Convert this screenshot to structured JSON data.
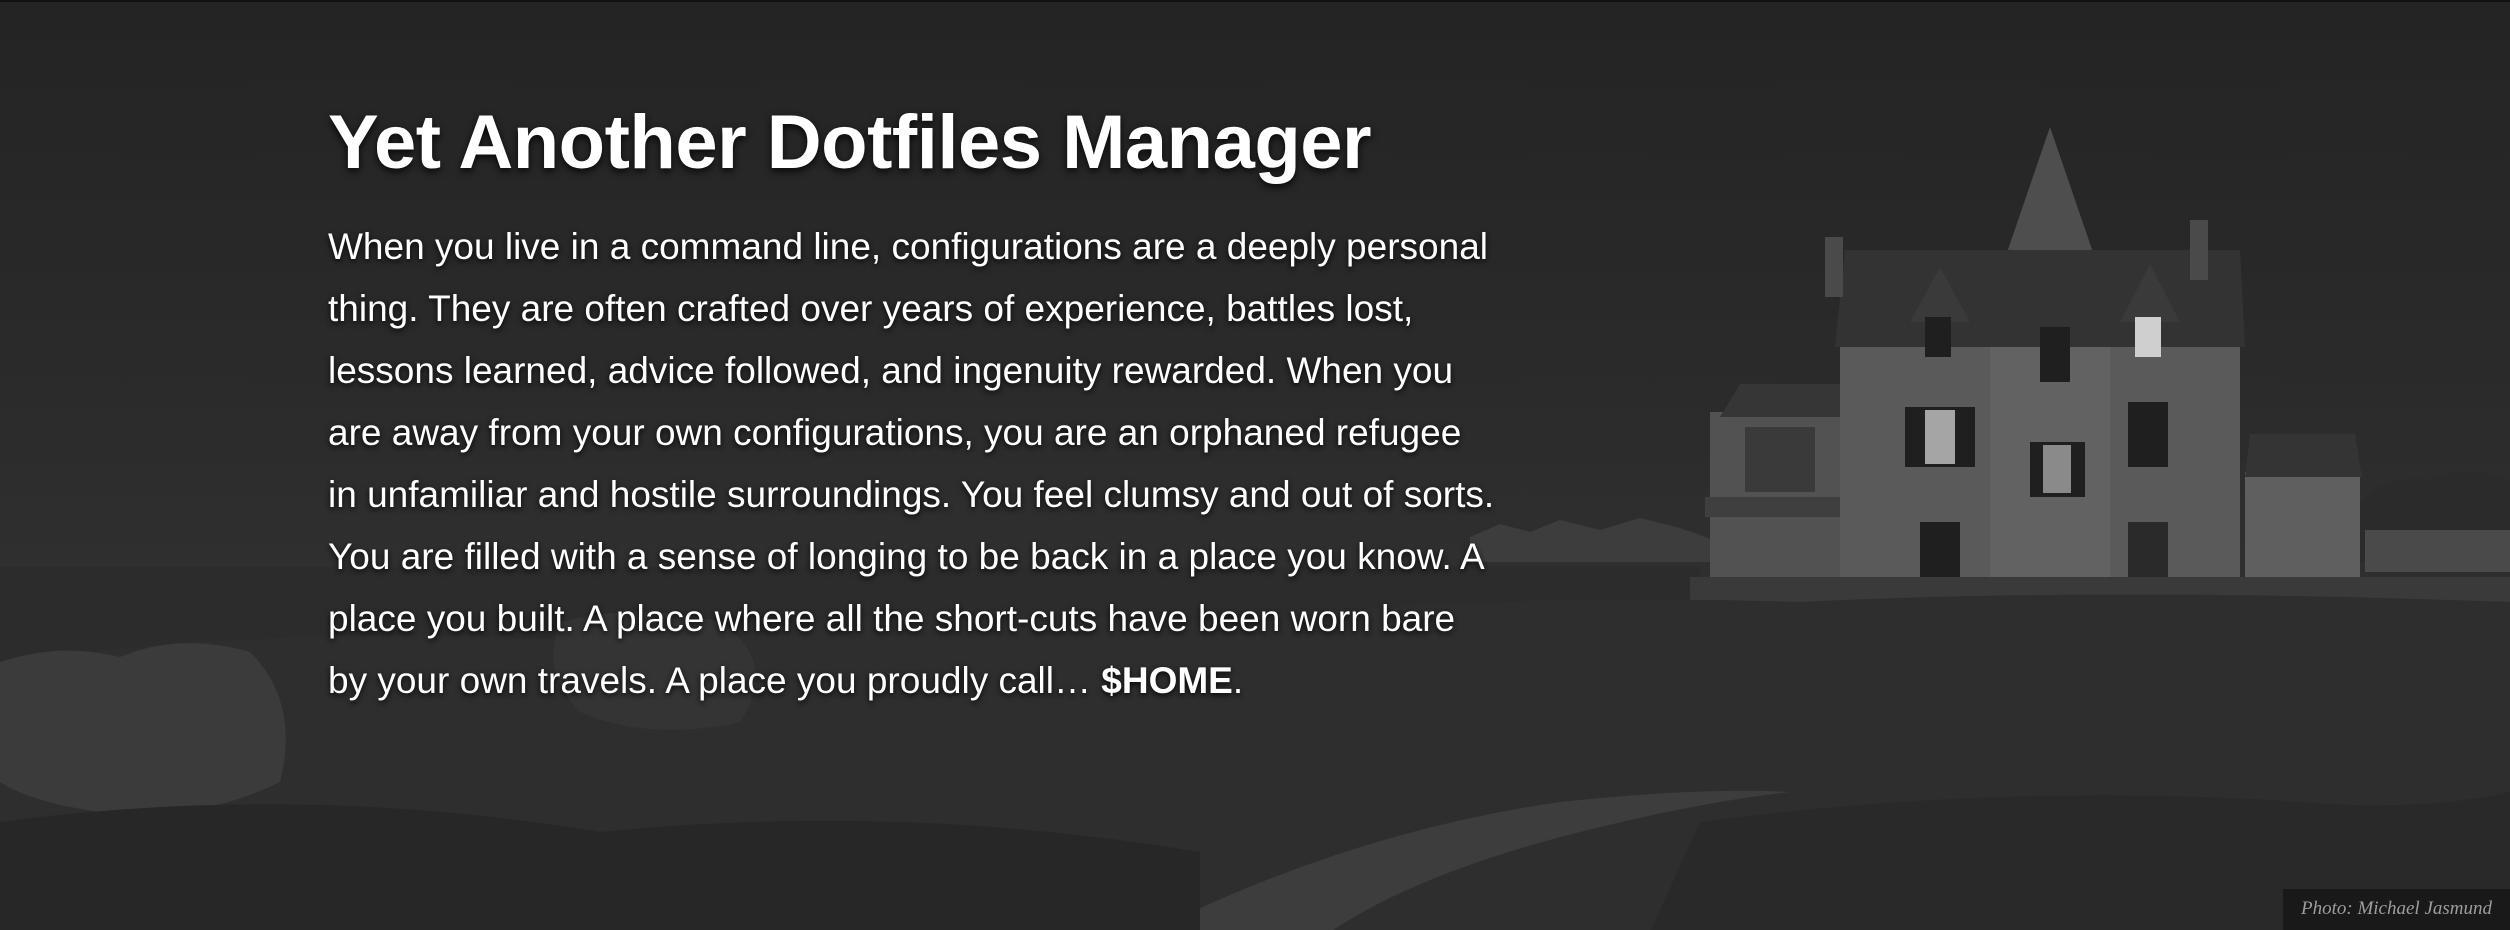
{
  "hero": {
    "title": "Yet Another Dotfiles Manager",
    "paragraph_lead": "When you live in a command line, configurations are a deeply personal thing. They are often crafted over years of experience, battles lost, lessons learned, advice followed, and ingenuity rewarded. When you are away from your own configurations, you are an orphaned refugee in unfamiliar and hostile surroundings. You feel clumsy and out of sorts. You are filled with a sense of longing to be back in a place you know. A place you built. A place where all the short-cuts have been worn bare by your own travels. A place you proudly call… ",
    "home_token": "$HOME",
    "paragraph_end": ".",
    "photo_credit": "Photo: Michael Jasmund"
  },
  "colors": {
    "overlay": "#2a2a2a",
    "text": "#ffffff",
    "credit_text": "#9d9d9d"
  }
}
